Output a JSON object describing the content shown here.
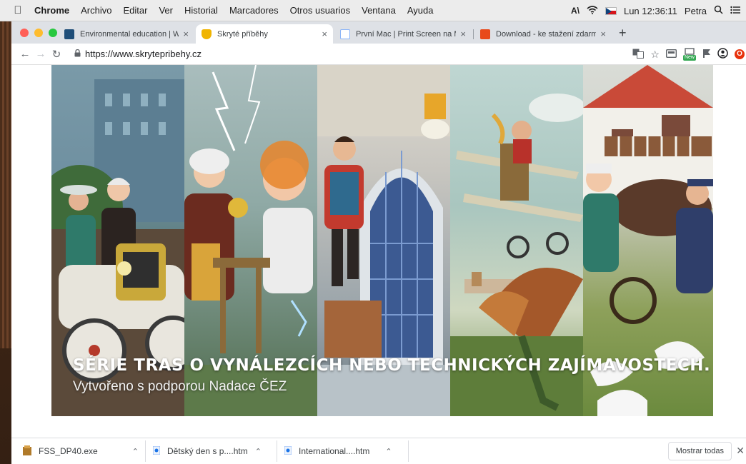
{
  "menubar": {
    "app_name": "Chrome",
    "items": [
      "Archivo",
      "Editar",
      "Ver",
      "Historial",
      "Marcadores",
      "Otros usuarios",
      "Ventana",
      "Ayuda"
    ],
    "clock": "Lun 12:36:11",
    "user": "Petra",
    "icons": [
      "apple-icon",
      "adobe-icon",
      "wifi-icon",
      "czech-flag-icon",
      "spotlight-icon",
      "list-icon"
    ]
  },
  "tabs": [
    {
      "title": "Environmental education | Wad",
      "favicon_color": "#1f4e79",
      "active": false
    },
    {
      "title": "Skryté příběhy",
      "favicon_color": "#f0b400",
      "active": true
    },
    {
      "title": "První Mac | Print Screen na Ma",
      "favicon_color": "#8ab4f8",
      "active": false
    },
    {
      "title": "Download - ke stažení zdarma",
      "favicon_color": "#e8491b",
      "active": false
    }
  ],
  "address_bar": {
    "url": "https://www.skrytepribehy.cz"
  },
  "toolbar": {
    "new_badge": "New"
  },
  "hero": {
    "title": "SÉRIE TRAS O VYNÁLEZCÍCH NEBO TECHNICKÝCH ZAJÍMAVOSTECH.",
    "subtitle": "Vytvořeno s podporou Nadace ČEZ",
    "panel_colors": [
      "#6e8fa0",
      "#8fa9a5",
      "#3f5f7a",
      "#a9c6bf",
      "#c94a38"
    ]
  },
  "downloads": {
    "items": [
      {
        "name": "FSS_DP40.exe"
      },
      {
        "name": "Dětský den s p....htm"
      },
      {
        "name": "International....htm"
      }
    ],
    "show_all": "Mostrar todas"
  }
}
